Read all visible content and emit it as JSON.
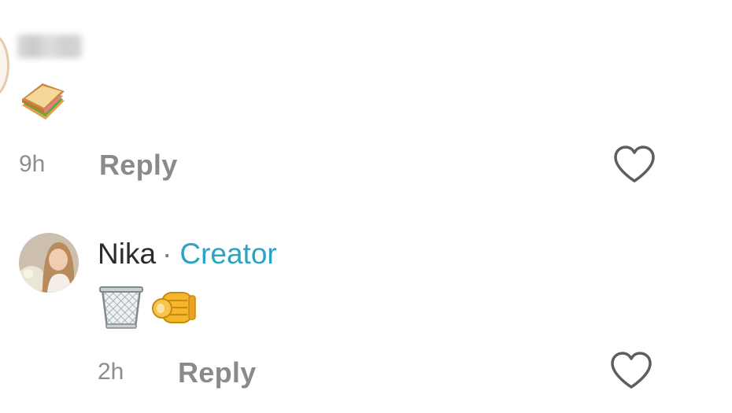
{
  "comments": [
    {
      "author_visible": false,
      "emoji": [
        "sandwich-emoji"
      ],
      "time": "9h",
      "reply_label": "Reply",
      "liked": false
    },
    {
      "author": "Nika",
      "separator": "·",
      "badge": "Creator",
      "emoji": [
        "wastebasket-emoji",
        "pointing-hand-emoji"
      ],
      "time": "2h",
      "reply_label": "Reply",
      "liked": false
    }
  ],
  "colors": {
    "creator_badge": "#2aa3c4",
    "meta_text": "#8e8e8e",
    "heart_outline": "#5e5e5e"
  }
}
